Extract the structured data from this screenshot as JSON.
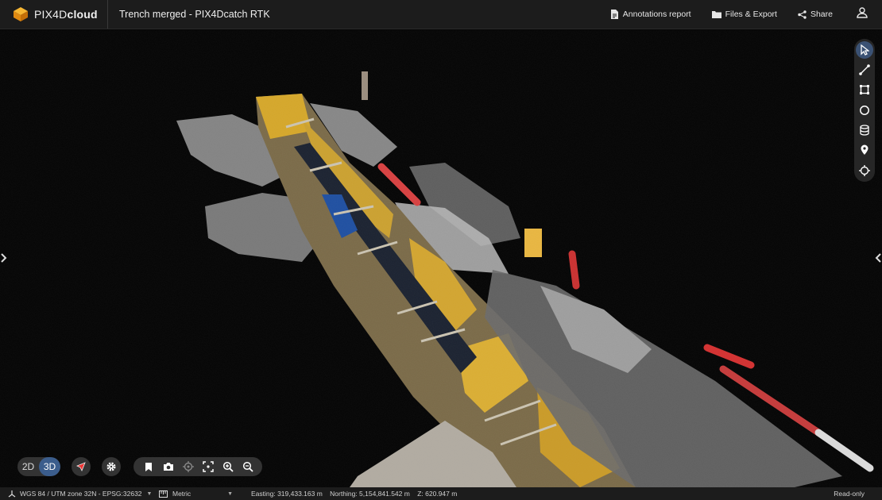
{
  "header": {
    "logo_text_regular": "PIX4D",
    "logo_text_bold": "cloud",
    "project_title": "Trench merged - PIX4Dcatch RTK",
    "actions": [
      {
        "label": "Annotations report",
        "icon": "report-icon"
      },
      {
        "label": "Files & Export",
        "icon": "folder-icon"
      },
      {
        "label": "Share",
        "icon": "share-icon"
      }
    ],
    "user_icon": "user-icon"
  },
  "toolbar_right": {
    "tools": [
      "select-pointer-icon",
      "polyline-measure-icon",
      "area-measure-icon",
      "circle-icon",
      "volume-icon",
      "marker-icon",
      "target-icon"
    ],
    "active_index": 0
  },
  "view_controls": {
    "mode_2d": "2D",
    "mode_3d": "3D",
    "active_mode": "3D"
  },
  "statusbar": {
    "crs": "WGS 84 / UTM zone 32N - EPSG:32632",
    "units": "Metric",
    "easting": "Easting: 319,433.163 m",
    "northing": "Northing: 5,154,841.542 m",
    "z": "Z: 620.947 m",
    "mode": "Read-only"
  },
  "colors": {
    "accent": "#3b5d8c",
    "header_bg": "#1c1c1c",
    "viewport_bg": "#040404",
    "logo_orange": "#f5a623"
  }
}
